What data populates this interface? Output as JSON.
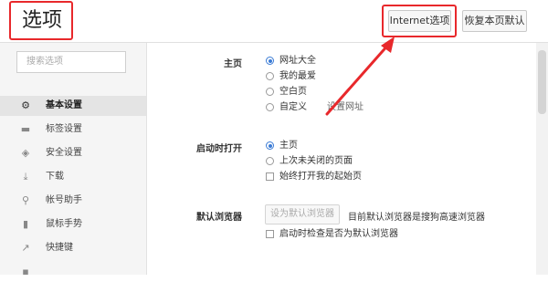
{
  "header": {
    "title": "选项",
    "internet_options_label": "Internet选项",
    "restore_defaults_label": "恢复本页默认"
  },
  "sidebar": {
    "search_placeholder": "搜索选项",
    "items": [
      {
        "label": "基本设置",
        "icon": "gear-icon",
        "active": true
      },
      {
        "label": "标签设置",
        "icon": "tab-icon",
        "active": false
      },
      {
        "label": "安全设置",
        "icon": "shield-icon",
        "active": false
      },
      {
        "label": "下载",
        "icon": "download-icon",
        "active": false
      },
      {
        "label": "帐号助手",
        "icon": "key-icon",
        "active": false
      },
      {
        "label": "鼠标手势",
        "icon": "mouse-icon",
        "active": false
      },
      {
        "label": "快捷键",
        "icon": "arrow-icon",
        "active": false
      },
      {
        "label": "",
        "icon": "unknown-icon",
        "active": false
      }
    ]
  },
  "main": {
    "homepage": {
      "label": "主页",
      "options": [
        "网址大全",
        "我的最爱",
        "空白页",
        "自定义"
      ],
      "selected": "网址大全",
      "set_url_label": "设置网址"
    },
    "startup": {
      "label": "启动时打开",
      "options": [
        "主页",
        "上次未关闭的页面"
      ],
      "selected": "主页",
      "checkbox_label": "始终打开我的起始页"
    },
    "default_browser": {
      "label": "默认浏览器",
      "button_label": "设为默认浏览器",
      "status": "目前默认浏览器是搜狗高速浏览器",
      "checkbox_label": "启动时检查是否为默认浏览器"
    }
  },
  "colors": {
    "highlight_red": "#e8282b",
    "radio_blue": "#3a7bd5"
  }
}
